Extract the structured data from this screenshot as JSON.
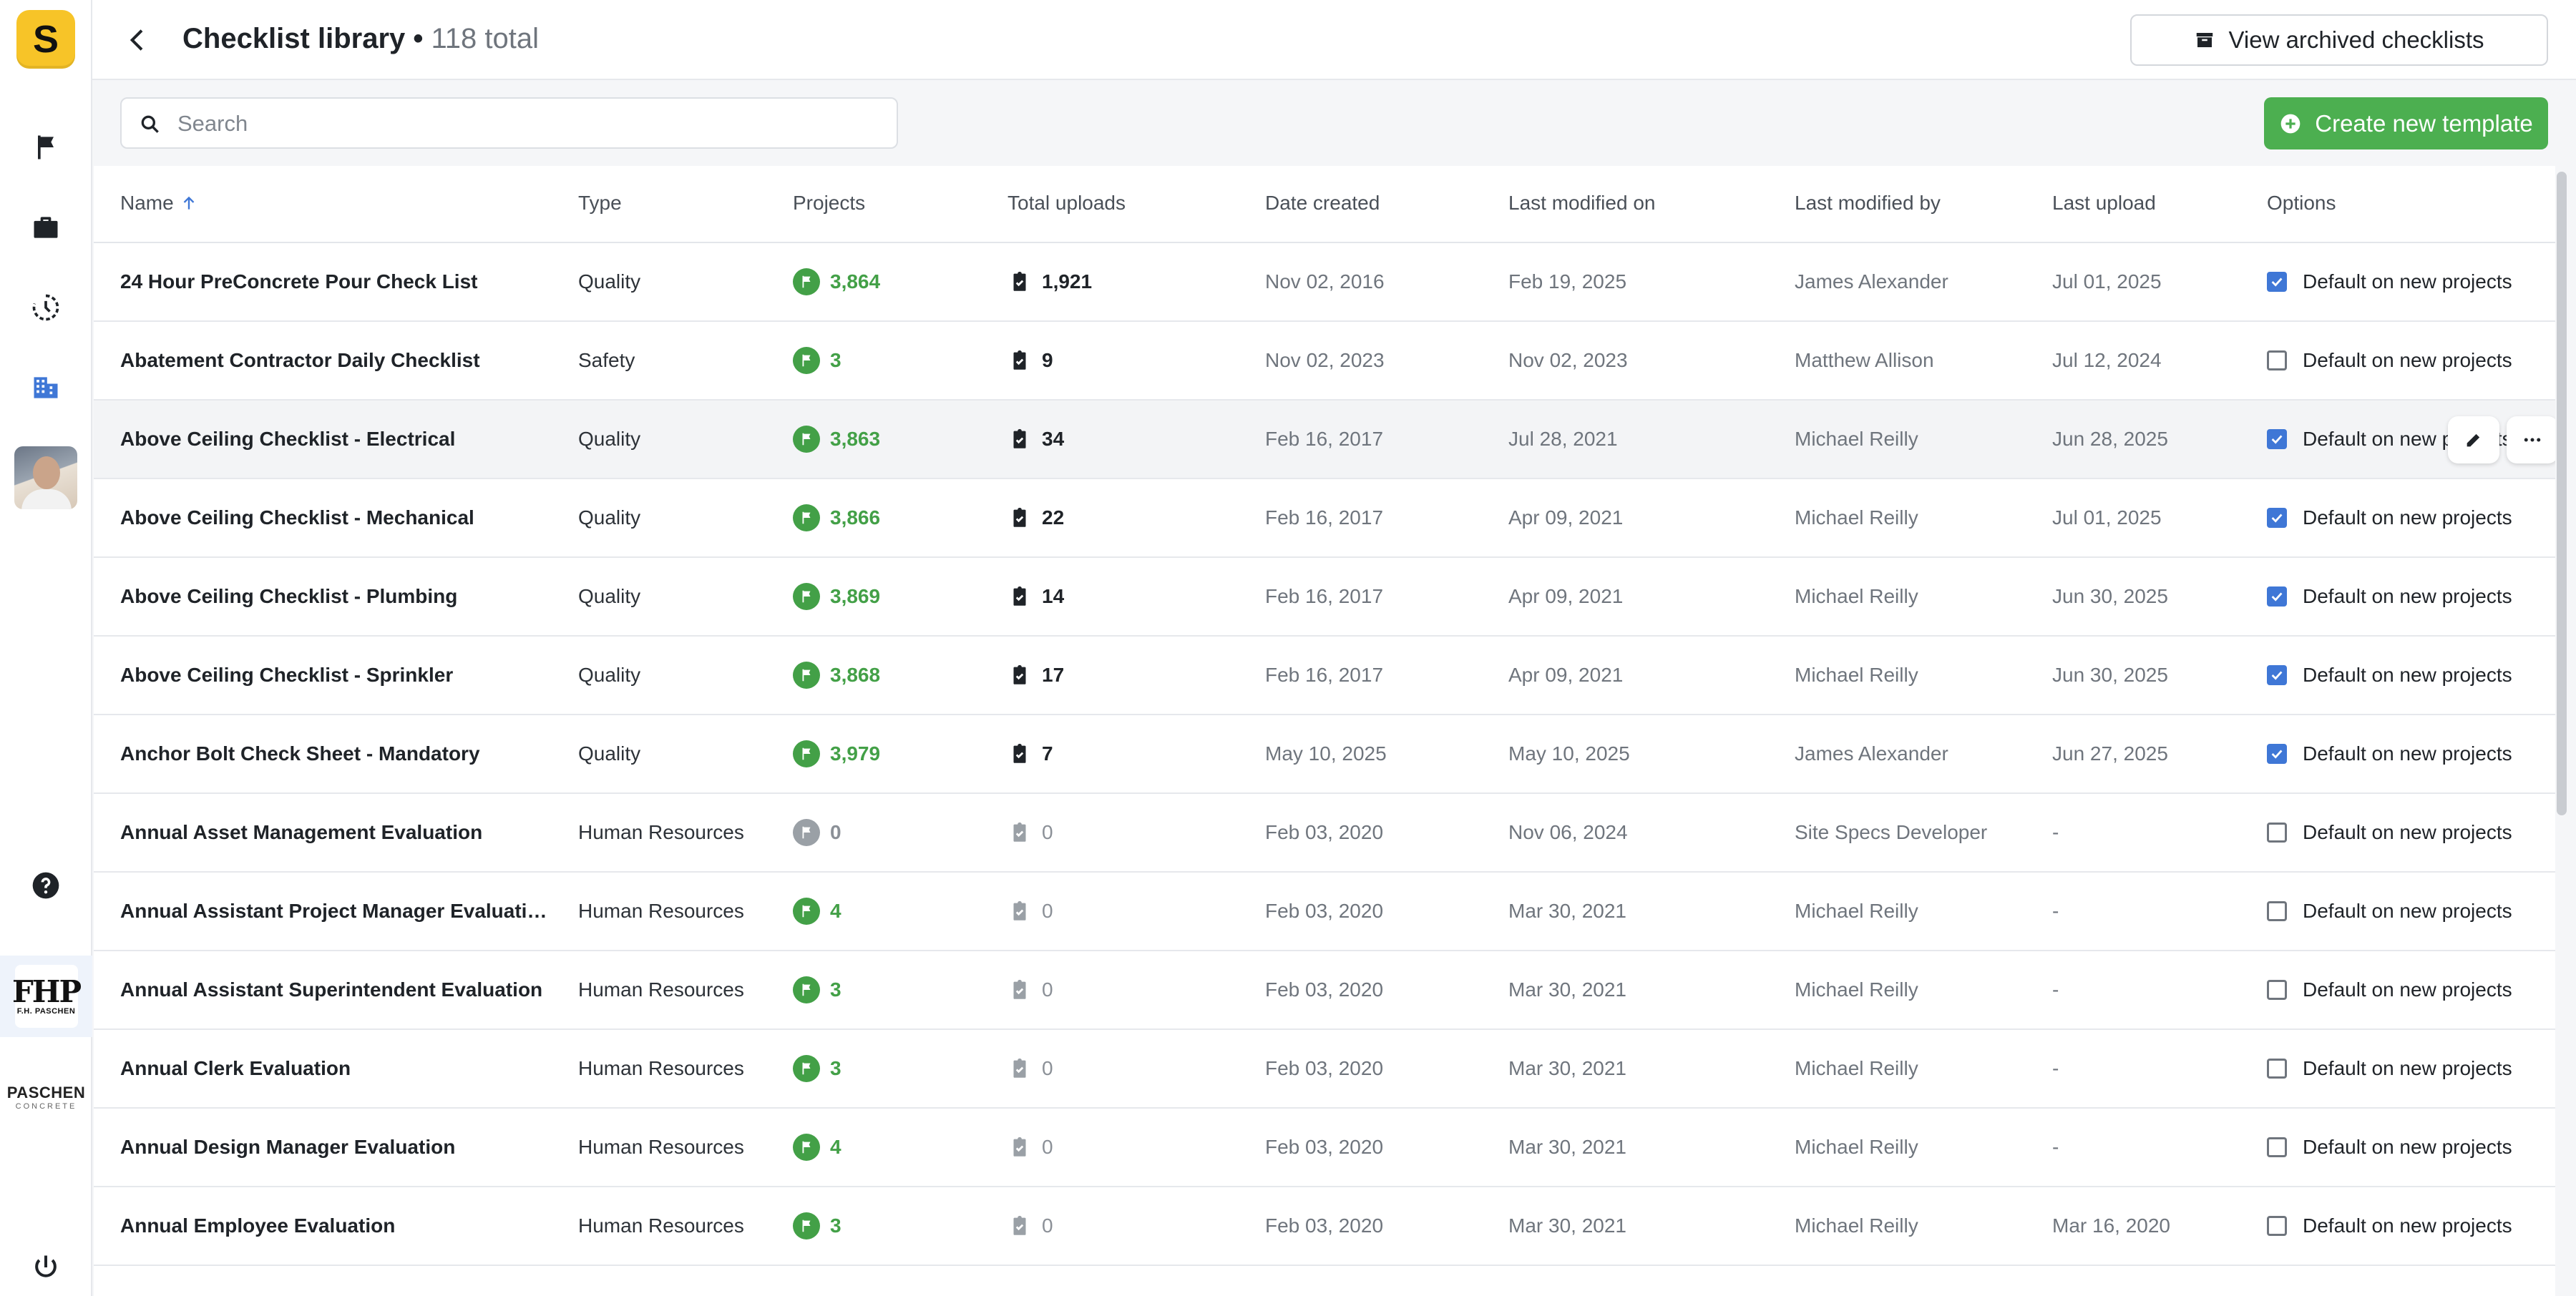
{
  "app": {
    "logo_letter": "S"
  },
  "header": {
    "title": "Checklist library",
    "separator": " • ",
    "count": "118 total",
    "archived_label": "View archived checklists"
  },
  "sidebar": {
    "items": [
      {
        "icon": "flag-icon"
      },
      {
        "icon": "briefcase-icon"
      },
      {
        "icon": "history-icon"
      },
      {
        "icon": "building-icon",
        "active": true
      }
    ],
    "companies": [
      {
        "big": "FHP",
        "small": "F.H. PASCHEN"
      },
      {
        "big": "PASCHEN",
        "small": "CONCRETE"
      }
    ]
  },
  "search": {
    "placeholder": "Search",
    "value": ""
  },
  "create_label": "Create new template",
  "columns": {
    "name": "Name",
    "type": "Type",
    "projects": "Projects",
    "uploads": "Total uploads",
    "created": "Date created",
    "modified": "Last modified on",
    "modified_by": "Last modified by",
    "last_upload": "Last upload",
    "options": "Options"
  },
  "rows": [
    {
      "name": "24 Hour PreConcrete Pour Check List",
      "type": "Quality",
      "projects": "3,864",
      "uploads": "1,921",
      "created": "Nov 02, 2016",
      "modified": "Feb 19, 2025",
      "modified_by": "James Alexander",
      "last_upload": "Jul 01, 2025",
      "default": true,
      "option_label": "Default on new projects"
    },
    {
      "name": "Abatement Contractor Daily Checklist",
      "type": "Safety",
      "projects": "3",
      "uploads": "9",
      "created": "Nov 02, 2023",
      "modified": "Nov 02, 2023",
      "modified_by": "Matthew Allison",
      "last_upload": "Jul 12, 2024",
      "default": false,
      "option_label": "Default on new projects"
    },
    {
      "name": "Above Ceiling Checklist - Electrical",
      "type": "Quality",
      "projects": "3,863",
      "uploads": "34",
      "created": "Feb 16, 2017",
      "modified": "Jul 28, 2021",
      "modified_by": "Michael Reilly",
      "last_upload": "Jun 28, 2025",
      "default": true,
      "option_label": "Default on new projects"
    },
    {
      "name": "Above Ceiling Checklist - Mechanical",
      "type": "Quality",
      "projects": "3,866",
      "uploads": "22",
      "created": "Feb 16, 2017",
      "modified": "Apr 09, 2021",
      "modified_by": "Michael Reilly",
      "last_upload": "Jul 01, 2025",
      "default": true,
      "option_label": "Default on new projects"
    },
    {
      "name": "Above Ceiling Checklist - Plumbing",
      "type": "Quality",
      "projects": "3,869",
      "uploads": "14",
      "created": "Feb 16, 2017",
      "modified": "Apr 09, 2021",
      "modified_by": "Michael Reilly",
      "last_upload": "Jun 30, 2025",
      "default": true,
      "option_label": "Default on new projects"
    },
    {
      "name": "Above Ceiling Checklist - Sprinkler",
      "type": "Quality",
      "projects": "3,868",
      "uploads": "17",
      "created": "Feb 16, 2017",
      "modified": "Apr 09, 2021",
      "modified_by": "Michael Reilly",
      "last_upload": "Jun 30, 2025",
      "default": true,
      "option_label": "Default on new projects"
    },
    {
      "name": "Anchor Bolt Check Sheet - Mandatory",
      "type": "Quality",
      "projects": "3,979",
      "uploads": "7",
      "created": "May 10, 2025",
      "modified": "May 10, 2025",
      "modified_by": "James Alexander",
      "last_upload": "Jun 27, 2025",
      "default": true,
      "option_label": "Default on new projects"
    },
    {
      "name": "Annual Asset Management Evaluation",
      "type": "Human Resources",
      "projects": "0",
      "uploads": "0",
      "created": "Feb 03, 2020",
      "modified": "Nov 06, 2024",
      "modified_by": "Site Specs Developer",
      "last_upload": "-",
      "default": false,
      "option_label": "Default on new projects"
    },
    {
      "name": "Annual Assistant Project Manager Evaluati…",
      "type": "Human Resources",
      "projects": "4",
      "uploads": "0",
      "created": "Feb 03, 2020",
      "modified": "Mar 30, 2021",
      "modified_by": "Michael Reilly",
      "last_upload": "-",
      "default": false,
      "option_label": "Default on new projects"
    },
    {
      "name": "Annual Assistant Superintendent Evaluation",
      "type": "Human Resources",
      "projects": "3",
      "uploads": "0",
      "created": "Feb 03, 2020",
      "modified": "Mar 30, 2021",
      "modified_by": "Michael Reilly",
      "last_upload": "-",
      "default": false,
      "option_label": "Default on new projects"
    },
    {
      "name": "Annual Clerk Evaluation",
      "type": "Human Resources",
      "projects": "3",
      "uploads": "0",
      "created": "Feb 03, 2020",
      "modified": "Mar 30, 2021",
      "modified_by": "Michael Reilly",
      "last_upload": "-",
      "default": false,
      "option_label": "Default on new projects"
    },
    {
      "name": "Annual Design Manager Evaluation",
      "type": "Human Resources",
      "projects": "4",
      "uploads": "0",
      "created": "Feb 03, 2020",
      "modified": "Mar 30, 2021",
      "modified_by": "Michael Reilly",
      "last_upload": "-",
      "default": false,
      "option_label": "Default on new projects"
    },
    {
      "name": "Annual Employee Evaluation",
      "type": "Human Resources",
      "projects": "3",
      "uploads": "0",
      "created": "Feb 03, 2020",
      "modified": "Mar 30, 2021",
      "modified_by": "Michael Reilly",
      "last_upload": "Mar 16, 2020",
      "default": false,
      "option_label": "Default on new projects"
    }
  ],
  "hover_row_index": 2,
  "colors": {
    "accent": "#4caf50",
    "checkbox": "#3f77d6",
    "brand": "#f7c428"
  }
}
